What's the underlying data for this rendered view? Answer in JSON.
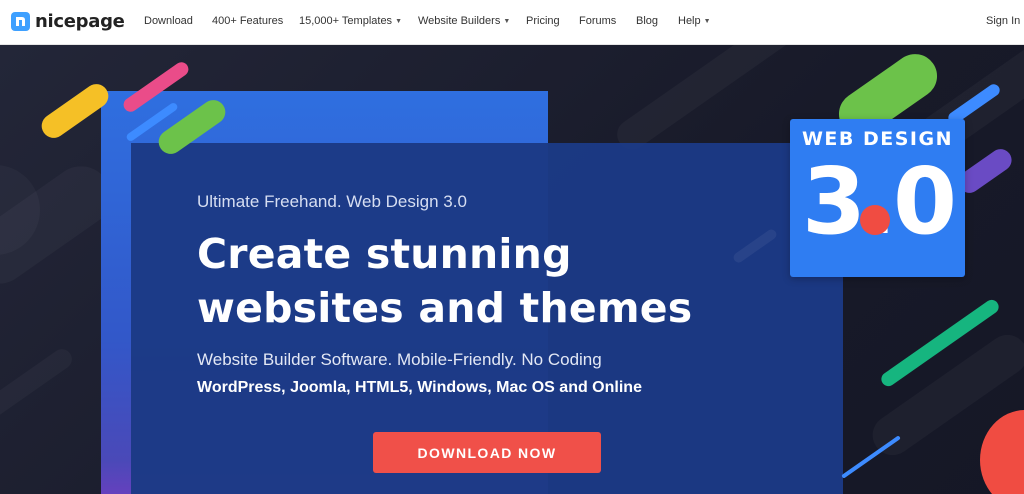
{
  "brand": {
    "name": "nicepage",
    "logo_letter": "n"
  },
  "nav": {
    "items": [
      {
        "label": "Download",
        "dropdown": false
      },
      {
        "label": "400+ Features",
        "dropdown": false
      },
      {
        "label": "15,000+ Templates",
        "dropdown": true
      },
      {
        "label": "Website Builders",
        "dropdown": true
      },
      {
        "label": "Pricing",
        "dropdown": false
      },
      {
        "label": "Forums",
        "dropdown": false
      },
      {
        "label": "Blog",
        "dropdown": false
      },
      {
        "label": "Help",
        "dropdown": true
      }
    ],
    "sign_in": "Sign In"
  },
  "hero": {
    "eyebrow": "Ultimate Freehand. Web Design 3.0",
    "title_line1": "Create stunning",
    "title_line2": "websites and themes",
    "subtitle": "Website Builder Software. Mobile-Friendly. No Coding",
    "platforms": "WordPress, Joomla, HTML5, Windows, Mac OS and Online",
    "cta_label": "DOWNLOAD NOW"
  },
  "badge": {
    "top_text": "WEB DESIGN",
    "number": "3.0"
  },
  "colors": {
    "accent_blue": "#2f7df2",
    "cta_red": "#f05049",
    "stripe_yellow": "#f5c026",
    "stripe_pink": "#ea4c89",
    "stripe_green": "#6cc24a",
    "stripe_teal": "#16b57f",
    "stripe_purple": "#6a4bc4"
  }
}
